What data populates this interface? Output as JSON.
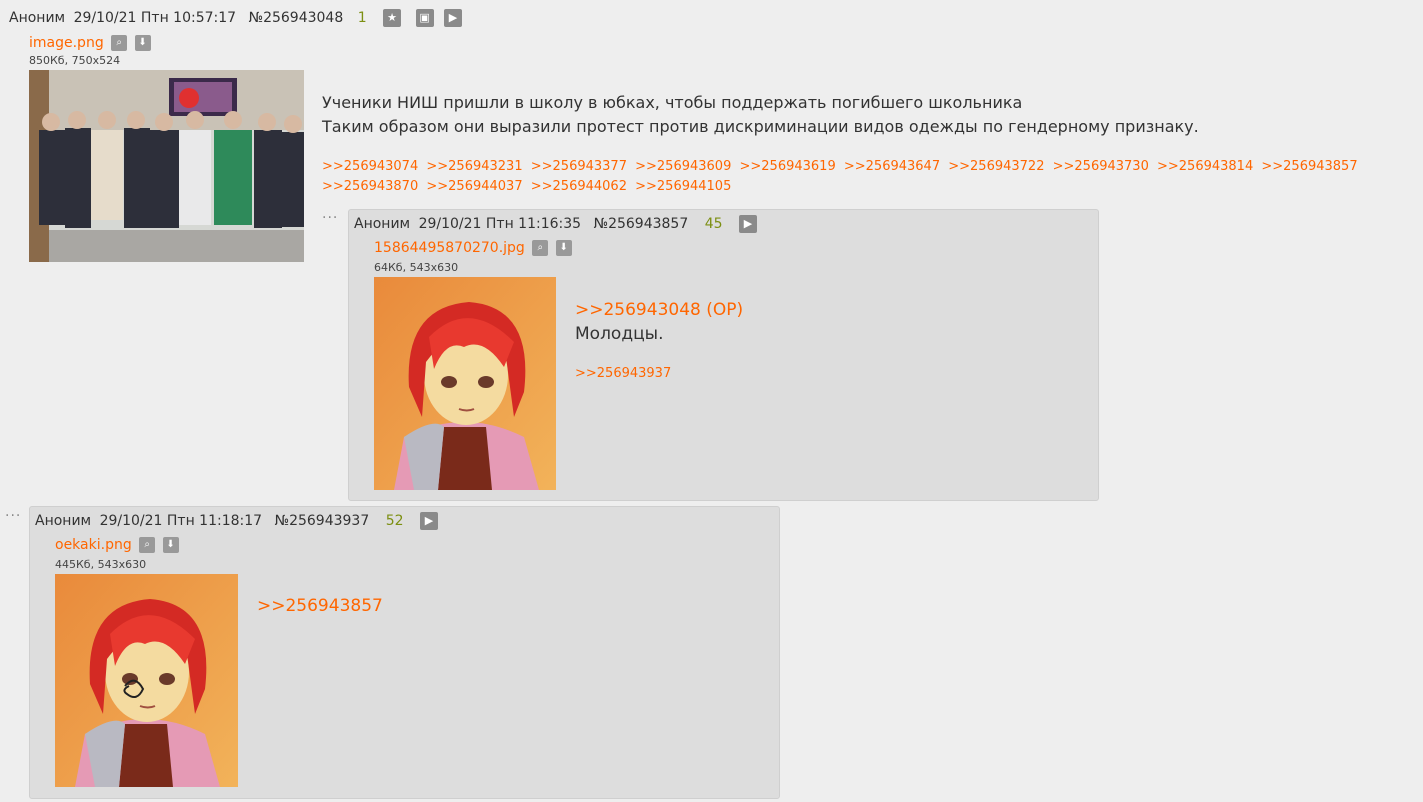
{
  "op": {
    "author": "Аноним",
    "datetime": "29/10/21 Птн 10:57:17",
    "num": "№256943048",
    "count": "1",
    "file": {
      "name": "image.png",
      "meta": "850Кб, 750x524"
    },
    "text_line1": "Ученики НИШ пришли в школу в юбках, чтобы поддержать погибшего школьника",
    "text_line2": "Таким образом они выразили протест против дискриминации видов одежды по гендерному признаку.",
    "replies": [
      ">>256943074",
      ">>256943231",
      ">>256943377",
      ">>256943609",
      ">>256943619",
      ">>256943647",
      ">>256943722",
      ">>256943730",
      ">>256943814",
      ">>256943857",
      ">>256943870",
      ">>256944037",
      ">>256944062",
      ">>256944105"
    ]
  },
  "reply1": {
    "author": "Аноним",
    "datetime": "29/10/21 Птн 11:16:35",
    "num": "№256943857",
    "count": "45",
    "file": {
      "name": "15864495870270.jpg",
      "meta": "64Кб, 543x630"
    },
    "quote": ">>256943048 (OP)",
    "text": "Молодцы.",
    "reply_link": ">>256943937"
  },
  "reply2": {
    "author": "Аноним",
    "datetime": "29/10/21 Птн 11:18:17",
    "num": "№256943937",
    "count": "52",
    "file": {
      "name": "oekaki.png",
      "meta": "445Кб, 543x630"
    },
    "quote": ">>256943857"
  },
  "colors": {
    "link": "#ff6600",
    "count": "#7c8f12",
    "bg": "#eeeeee",
    "reply_bg": "#dddddd"
  },
  "icons": [
    "star-icon",
    "expand-icon",
    "play-icon",
    "search-icon",
    "download-icon",
    "more-dots-icon"
  ]
}
